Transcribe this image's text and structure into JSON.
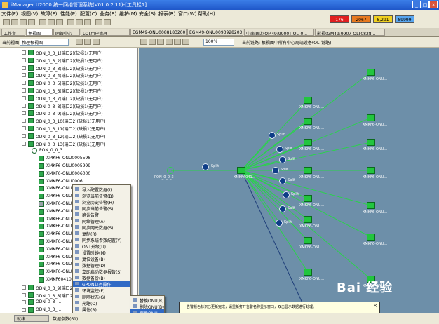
{
  "window": {
    "title": "iManager U2000 统一网络管理系统(V01.0.2.11)-[工具栏1]"
  },
  "menu": [
    "文件(F)",
    "视图(V)",
    "故障(F)",
    "性能(P)",
    "配置(C)",
    "业务(B)",
    "维护(M)",
    "安全(S)",
    "报表(R)",
    "窗口(W)",
    "帮助(H)"
  ],
  "alarms": [
    {
      "value": "176",
      "color": "#e02020"
    },
    {
      "value": "2067",
      "color": "#e87a20"
    },
    {
      "value": "8,291",
      "color": "#f0d020"
    },
    {
      "value": "89999",
      "color": "#58a6f0"
    }
  ],
  "tabs": [
    {
      "label": "工作台"
    },
    {
      "label": "主视图"
    },
    {
      "label": "网管中心"
    },
    {
      "label": "LCT用户管理"
    },
    {
      "label": "EGM49-ONU0088183200.8.32..."
    },
    {
      "label": "EGM49-ONU0093928203.8.32..."
    },
    {
      "label": "中南酒店(OM49:9900T-OLT0..."
    },
    {
      "label": "影视(GM49:9907-OLT0828..."
    }
  ],
  "toolbar2": {
    "view_label": "当前视图",
    "view_select": "物理根视图",
    "zoom": "100%",
    "path": "当前链路: 根视图中所有中心局端设备(OLT链路)"
  },
  "tree": [
    {
      "label": "ODN_0_3_1(端口2)(缺损1(无用户)",
      "type": "odn"
    },
    {
      "label": "ODN_0_3_2(端口2)(缺损1(无用户)",
      "type": "odn"
    },
    {
      "label": "ODN_0_3_3(端口2)(缺损1(无用户)",
      "type": "odn"
    },
    {
      "label": "ODN_0_3_4(端口2)(缺损1(无用户)",
      "type": "odn"
    },
    {
      "label": "ODN_0_3_5(端口2)(缺损1(无用户)",
      "type": "odn"
    },
    {
      "label": "ODN_0_3_6(端口2)(缺损1(无用户)",
      "type": "odn"
    },
    {
      "label": "ODN_0_3_7(端口2)(缺损1(无用户)",
      "type": "odn"
    },
    {
      "label": "ODN_0_3_8(端口2)(缺损1(无用户)",
      "type": "odn"
    },
    {
      "label": "ODN_0_3_9(端口2)(缺损1(无用户)",
      "type": "odn"
    },
    {
      "label": "ODN_0_3_10(端口2)(缺损1(无用户)",
      "type": "odn"
    },
    {
      "label": "ODN_0_3_11(端口2)(缺损1(无用户)",
      "type": "odn"
    },
    {
      "label": "ODN_0_3_12(端口2)(缺损1(无用户)",
      "type": "odn"
    },
    {
      "label": "ODN_0_3_13(端口2)(缺损1(无用户)",
      "type": "odn"
    },
    {
      "label": "PON_0_0_3",
      "type": "pon"
    },
    {
      "label": "XMKF6-ONU0005598",
      "type": "onu"
    },
    {
      "label": "XMKF6-ONU0005999",
      "type": "onu"
    },
    {
      "label": "XMKF6-ONU0006000",
      "type": "onu"
    },
    {
      "label": "XMKF6-ONU0006...",
      "type": "onu"
    },
    {
      "label": "XMKF6-ONU00...",
      "type": "onu"
    },
    {
      "label": "XMKF6-ONU00...",
      "type": "onu"
    },
    {
      "label": "XMKF6-ONU00...",
      "type": "onu-sel"
    },
    {
      "label": "XMKF6-ONU00...",
      "type": "onu"
    },
    {
      "label": "XMKF6-ONU00...",
      "type": "onu"
    },
    {
      "label": "XMKF6-ONU00...",
      "type": "onu"
    },
    {
      "label": "XMKF6-ONU00...",
      "type": "onu"
    },
    {
      "label": "XMKF6-ONU00...",
      "type": "onu"
    },
    {
      "label": "XMKF6-ONU00...",
      "type": "onu"
    },
    {
      "label": "XMKF6-ONU00...",
      "type": "onu"
    },
    {
      "label": "XMKF6-ONU00...",
      "type": "onu"
    },
    {
      "label": "XMKF6-ONU00...",
      "type": "onu"
    },
    {
      "label": "XMKF6041003...",
      "type": "onu"
    },
    {
      "label": "ODN_0_3_9(端口2)(缺损1(无用户)",
      "type": "odn"
    },
    {
      "label": "ODN_0_3_8(端口2)(缺损1(无用户)",
      "type": "odn"
    },
    {
      "label": "ODN_0_3_...",
      "type": "odn"
    },
    {
      "label": "ODN_0_3_...",
      "type": "odn"
    }
  ],
  "context_menu": [
    {
      "label": "导入配置数据(I)"
    },
    {
      "label": "浏览当前告警(B)"
    },
    {
      "label": "浏览历史告警(H)"
    },
    {
      "label": "同步当前告警(S)"
    },
    {
      "label": "确认告警"
    },
    {
      "label": "网络管理(A)"
    },
    {
      "label": "同步网元数据(S)"
    },
    {
      "label": "复制(R)"
    },
    {
      "label": "同步系统参数配置(Y)"
    },
    {
      "label": "ONT升级(U)"
    },
    {
      "label": "设置时钟(M)"
    },
    {
      "label": "复位设备(B)"
    },
    {
      "label": "数据管理(D)"
    },
    {
      "label": "立即启动数据报告(S)"
    },
    {
      "label": "数据备份(B)"
    },
    {
      "label": "GPON业务操作",
      "highlight": true
    },
    {
      "label": "环境监控(E)"
    },
    {
      "label": "删除状态(G)"
    },
    {
      "label": "光路(O)"
    },
    {
      "label": "属性(R)"
    }
  ],
  "submenu": [
    {
      "label": "替换ONU(R)"
    },
    {
      "label": "删除ONU(D)"
    },
    {
      "label": "更换ONU...",
      "highlight": true
    },
    {
      "label": "同时转移(C)"
    }
  ],
  "topology": {
    "pon_label": "PON_0_0_3",
    "olt_label": "XMKF6041...",
    "split_label": "Split",
    "onu_label": "XMKF6-ONU..."
  },
  "tooltip": "告警颜色标识已更新完成，请重新打开告警名称显示窗口，双击显示数据进行处理。",
  "status": {
    "left": "就绪",
    "count": "数据条数(61)"
  },
  "watermark": "Bai 经验"
}
